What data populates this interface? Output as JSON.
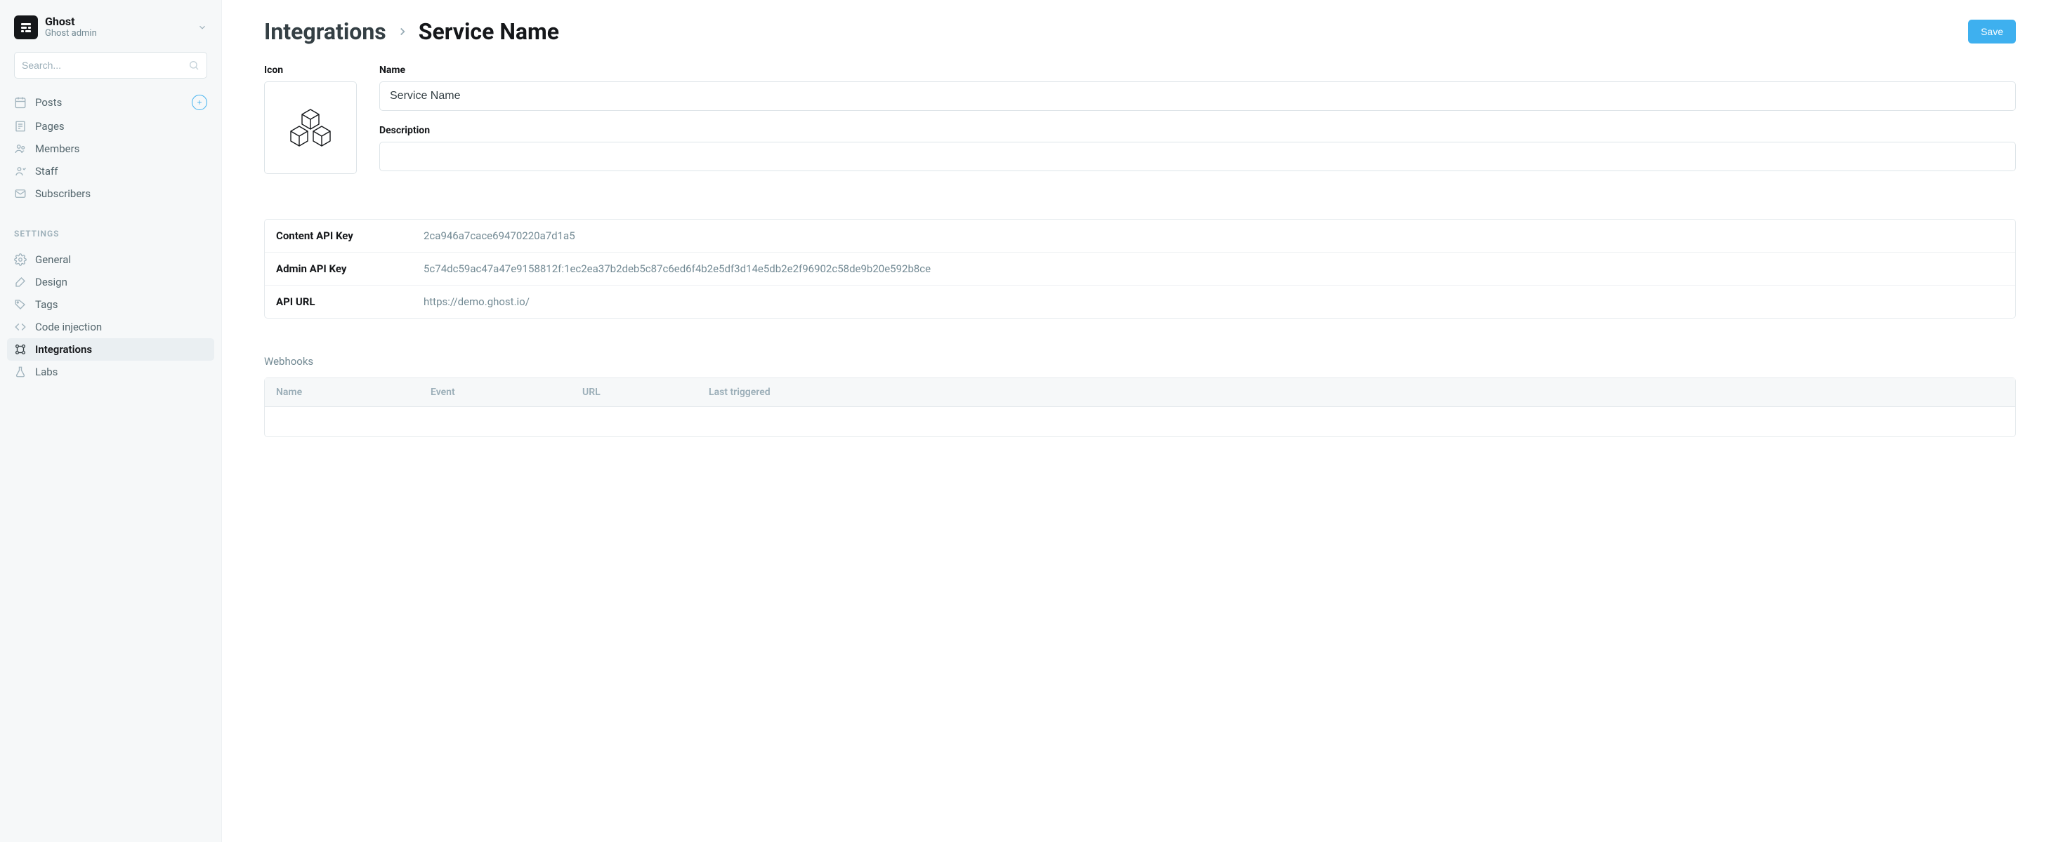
{
  "site": {
    "name": "Ghost",
    "subtitle": "Ghost admin"
  },
  "search": {
    "placeholder": "Search..."
  },
  "nav_main": [
    {
      "key": "posts",
      "label": "Posts",
      "has_plus": true
    },
    {
      "key": "pages",
      "label": "Pages"
    },
    {
      "key": "members",
      "label": "Members"
    },
    {
      "key": "staff",
      "label": "Staff"
    },
    {
      "key": "subscribers",
      "label": "Subscribers"
    }
  ],
  "nav_settings_label": "Settings",
  "nav_settings": [
    {
      "key": "general",
      "label": "General"
    },
    {
      "key": "design",
      "label": "Design"
    },
    {
      "key": "tags",
      "label": "Tags"
    },
    {
      "key": "code-injection",
      "label": "Code injection"
    },
    {
      "key": "integrations",
      "label": "Integrations",
      "active": true
    },
    {
      "key": "labs",
      "label": "Labs"
    }
  ],
  "page": {
    "breadcrumb_root": "Integrations",
    "breadcrumb_current": "Service Name",
    "save_label": "Save"
  },
  "form": {
    "icon_label": "Icon",
    "name_label": "Name",
    "name_value": "Service Name",
    "desc_label": "Description",
    "desc_value": ""
  },
  "api": {
    "rows": [
      {
        "label": "Content API Key",
        "value": "2ca946a7cace69470220a7d1a5"
      },
      {
        "label": "Admin API Key",
        "value": "5c74dc59ac47a47e9158812f:1ec2ea37b2deb5c87c6ed6f4b2e5df3d14e5db2e2f96902c58de9b20e592b8ce"
      },
      {
        "label": "API URL",
        "value": "https://demo.ghost.io/"
      }
    ]
  },
  "webhooks": {
    "section_label": "Webhooks",
    "columns": {
      "name": "Name",
      "event": "Event",
      "url": "URL",
      "last": "Last triggered"
    }
  }
}
